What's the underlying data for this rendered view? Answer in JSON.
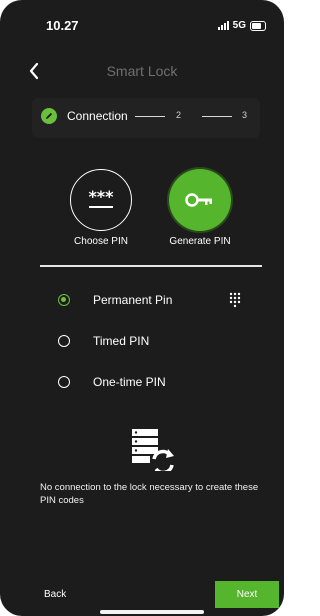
{
  "status": {
    "time": "10.27",
    "network": "5G"
  },
  "header": {
    "title": "Smart Lock"
  },
  "stepper": {
    "step1_label": "Connection",
    "step2": "2",
    "step3": "3"
  },
  "options": [
    {
      "label": "Choose PIN",
      "icon": "asterisk-pin-icon"
    },
    {
      "label": "Generate PIN",
      "icon": "key-icon"
    }
  ],
  "pin_types": [
    {
      "label": "Permanent Pin",
      "selected": true
    },
    {
      "label": "Timed PIN",
      "selected": false
    },
    {
      "label": "One-time PIN",
      "selected": false
    }
  ],
  "info": {
    "text": "No connection to the lock necessary to create these PIN codes",
    "icon": "server-sync-icon"
  },
  "footer": {
    "back_label": "Back",
    "next_label": "Next"
  },
  "colors": {
    "accent": "#55b52c",
    "background": "#1c1c1c"
  }
}
